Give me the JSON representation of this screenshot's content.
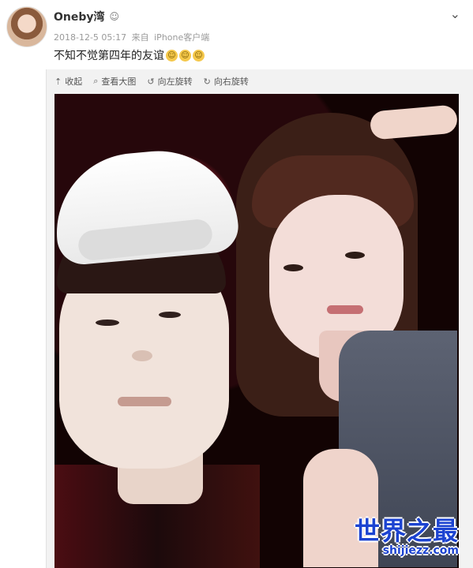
{
  "post": {
    "username": "Oneby湾",
    "timestamp": "2018-12-5 05:17",
    "source_prefix": "来自",
    "source_device": "iPhone客户端",
    "text": "不知不觉第四年的友谊",
    "emoji_count": 3
  },
  "toolbar": {
    "collapse_label": "收起",
    "view_large_label": "查看大图",
    "rotate_left_label": "向左旋转",
    "rotate_right_label": "向右旋转"
  },
  "watermark": {
    "main": "世界之最",
    "domain": "shijiezz.com"
  },
  "icons": {
    "collapse": "arrow-up-icon",
    "view_large": "search-icon",
    "rotate_left": "rotate-left-icon",
    "rotate_right": "rotate-right-icon",
    "more": "chevron-down-icon"
  },
  "colors": {
    "text_primary": "#333333",
    "meta_text": "#9a9a9a",
    "watermark_blue": "#1c43d1"
  }
}
